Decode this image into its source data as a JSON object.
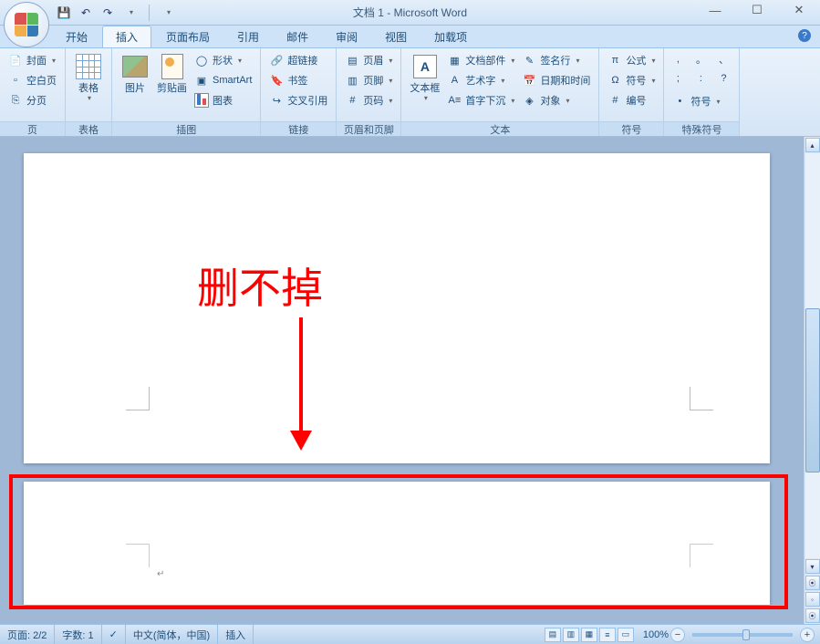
{
  "title": "文档 1 - Microsoft Word",
  "qat": {
    "save": "💾",
    "undo": "↶",
    "redo": "↷"
  },
  "tabs": [
    "开始",
    "插入",
    "页面布局",
    "引用",
    "邮件",
    "审阅",
    "视图",
    "加载项"
  ],
  "active_tab": 1,
  "ribbon": {
    "groups": [
      {
        "label": "页",
        "items": [
          {
            "kind": "sm",
            "icon": "📄",
            "text": "封面",
            "dd": true
          },
          {
            "kind": "sm",
            "icon": "▫",
            "text": "空白页"
          },
          {
            "kind": "sm",
            "icon": "⎘",
            "text": "分页"
          }
        ]
      },
      {
        "label": "表格",
        "items": [
          {
            "kind": "big",
            "icon": "table",
            "text": "表格",
            "dd": true
          }
        ]
      },
      {
        "label": "插图",
        "items": [
          {
            "kind": "big",
            "icon": "img",
            "text": "图片"
          },
          {
            "kind": "big",
            "icon": "clip",
            "text": "剪贴画"
          },
          {
            "kind": "smcol",
            "rows": [
              {
                "icon": "◯",
                "text": "形状",
                "dd": true
              },
              {
                "icon": "▣",
                "text": "SmartArt"
              },
              {
                "icon": "chart",
                "text": "图表"
              }
            ]
          }
        ]
      },
      {
        "label": "链接",
        "items": [
          {
            "kind": "smcol",
            "rows": [
              {
                "icon": "🔗",
                "text": "超链接"
              },
              {
                "icon": "🔖",
                "text": "书签"
              },
              {
                "icon": "↪",
                "text": "交叉引用"
              }
            ]
          }
        ]
      },
      {
        "label": "页眉和页脚",
        "items": [
          {
            "kind": "smcol",
            "rows": [
              {
                "icon": "▤",
                "text": "页眉",
                "dd": true
              },
              {
                "icon": "▥",
                "text": "页脚",
                "dd": true
              },
              {
                "icon": "#",
                "text": "页码",
                "dd": true
              }
            ]
          }
        ]
      },
      {
        "label": "文本",
        "items": [
          {
            "kind": "big",
            "icon": "A",
            "text": "文本框",
            "dd": true
          },
          {
            "kind": "smcol",
            "rows": [
              {
                "icon": "▦",
                "text": "文档部件",
                "dd": true
              },
              {
                "icon": "A",
                "text": "艺术字",
                "dd": true
              },
              {
                "icon": "A≡",
                "text": "首字下沉",
                "dd": true
              }
            ]
          },
          {
            "kind": "smcol",
            "rows": [
              {
                "icon": "✎",
                "text": "签名行",
                "dd": true
              },
              {
                "icon": "📅",
                "text": "日期和时间"
              },
              {
                "icon": "◈",
                "text": "对象",
                "dd": true
              }
            ]
          }
        ]
      },
      {
        "label": "符号",
        "items": [
          {
            "kind": "smcol",
            "rows": [
              {
                "icon": "π",
                "text": "公式",
                "dd": true
              },
              {
                "icon": "Ω",
                "text": "符号",
                "dd": true
              },
              {
                "icon": "#",
                "text": "编号"
              }
            ]
          }
        ]
      },
      {
        "label": "特殊符号",
        "items": [
          {
            "kind": "grid",
            "cells": [
              ",",
              "。",
              "、",
              ";",
              ":",
              "?",
              "•",
              "符号"
            ],
            "dd": true
          }
        ]
      }
    ]
  },
  "annotation": {
    "text": "删不掉"
  },
  "statusbar": {
    "page": "页面: 2/2",
    "words": "字数: 1",
    "lang": "中文(简体，中国)",
    "mode": "插入",
    "zoom": "100%"
  }
}
